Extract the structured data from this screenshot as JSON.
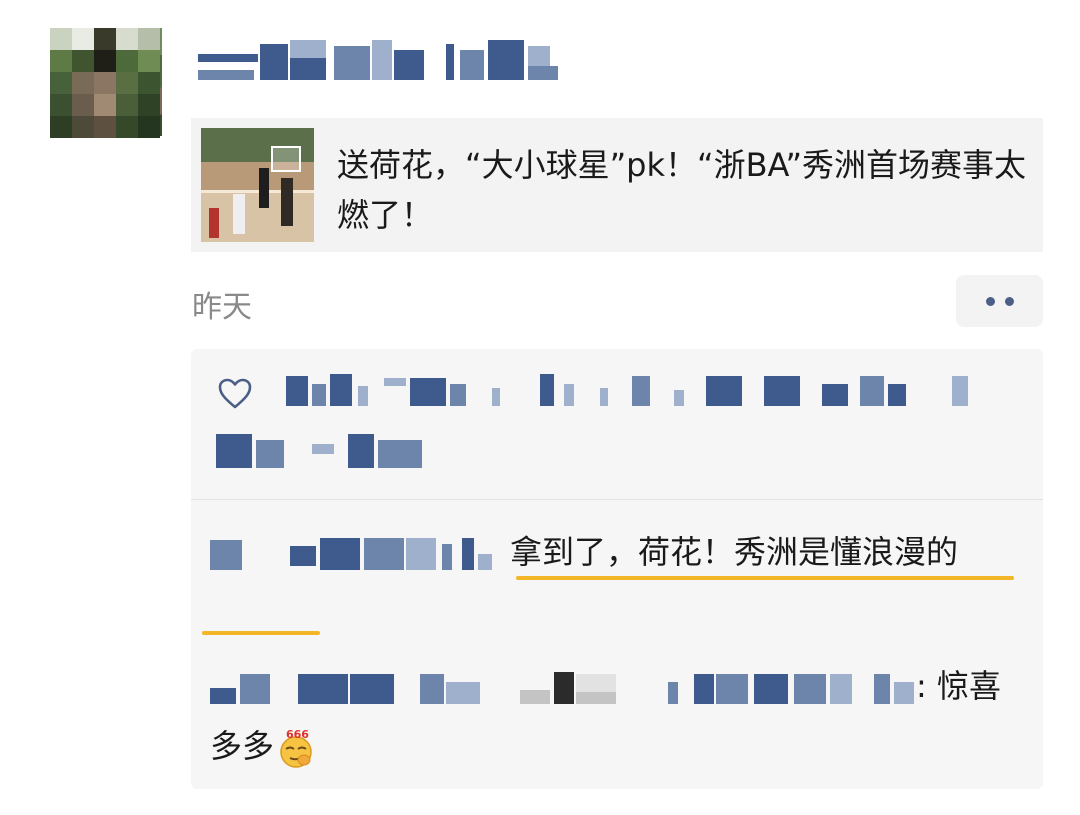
{
  "post": {
    "link": {
      "title": "送荷花，“大小球星”pk！“浙BA”秀洲首场赛事太燃了！"
    },
    "time": "昨天",
    "more_icon": "more-dots-icon"
  },
  "likes": {
    "icon": "heart-icon"
  },
  "comments": [
    {
      "text": "拿到了，荷花！秀洲是懂浪漫的"
    },
    {
      "text": ": 惊喜多多",
      "emoji": "666-emoji"
    }
  ],
  "colors": {
    "name_blue": "#3f5a8c",
    "highlight": "#f2b627",
    "card_bg": "#f3f3f3",
    "time_grey": "#8a8a8a"
  }
}
